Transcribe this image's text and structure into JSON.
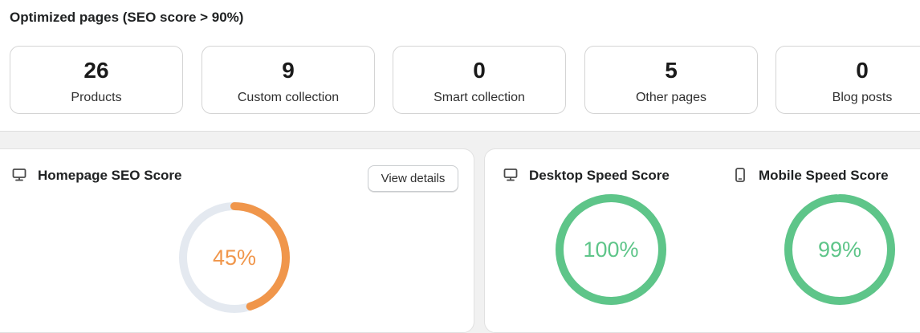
{
  "optimized": {
    "title": "Optimized pages (SEO score > 90%)",
    "stats": [
      {
        "value": "26",
        "label": "Products"
      },
      {
        "value": "9",
        "label": "Custom collection"
      },
      {
        "value": "0",
        "label": "Smart collection"
      },
      {
        "value": "5",
        "label": "Other pages"
      },
      {
        "value": "0",
        "label": "Blog posts"
      }
    ]
  },
  "homepage_seo": {
    "title": "Homepage SEO Score",
    "icon": "desktop-icon",
    "button_label": "View details",
    "score": 45,
    "score_text": "45%",
    "color": "#f0964b",
    "track_color": "#e4e9f0"
  },
  "desktop_speed": {
    "title": "Desktop Speed Score",
    "icon": "desktop-icon",
    "score": 100,
    "score_text": "100%",
    "color": "#5ec589"
  },
  "mobile_speed": {
    "title": "Mobile Speed Score",
    "icon": "mobile-icon",
    "score": 99,
    "score_text": "99%",
    "color": "#5ec589"
  }
}
